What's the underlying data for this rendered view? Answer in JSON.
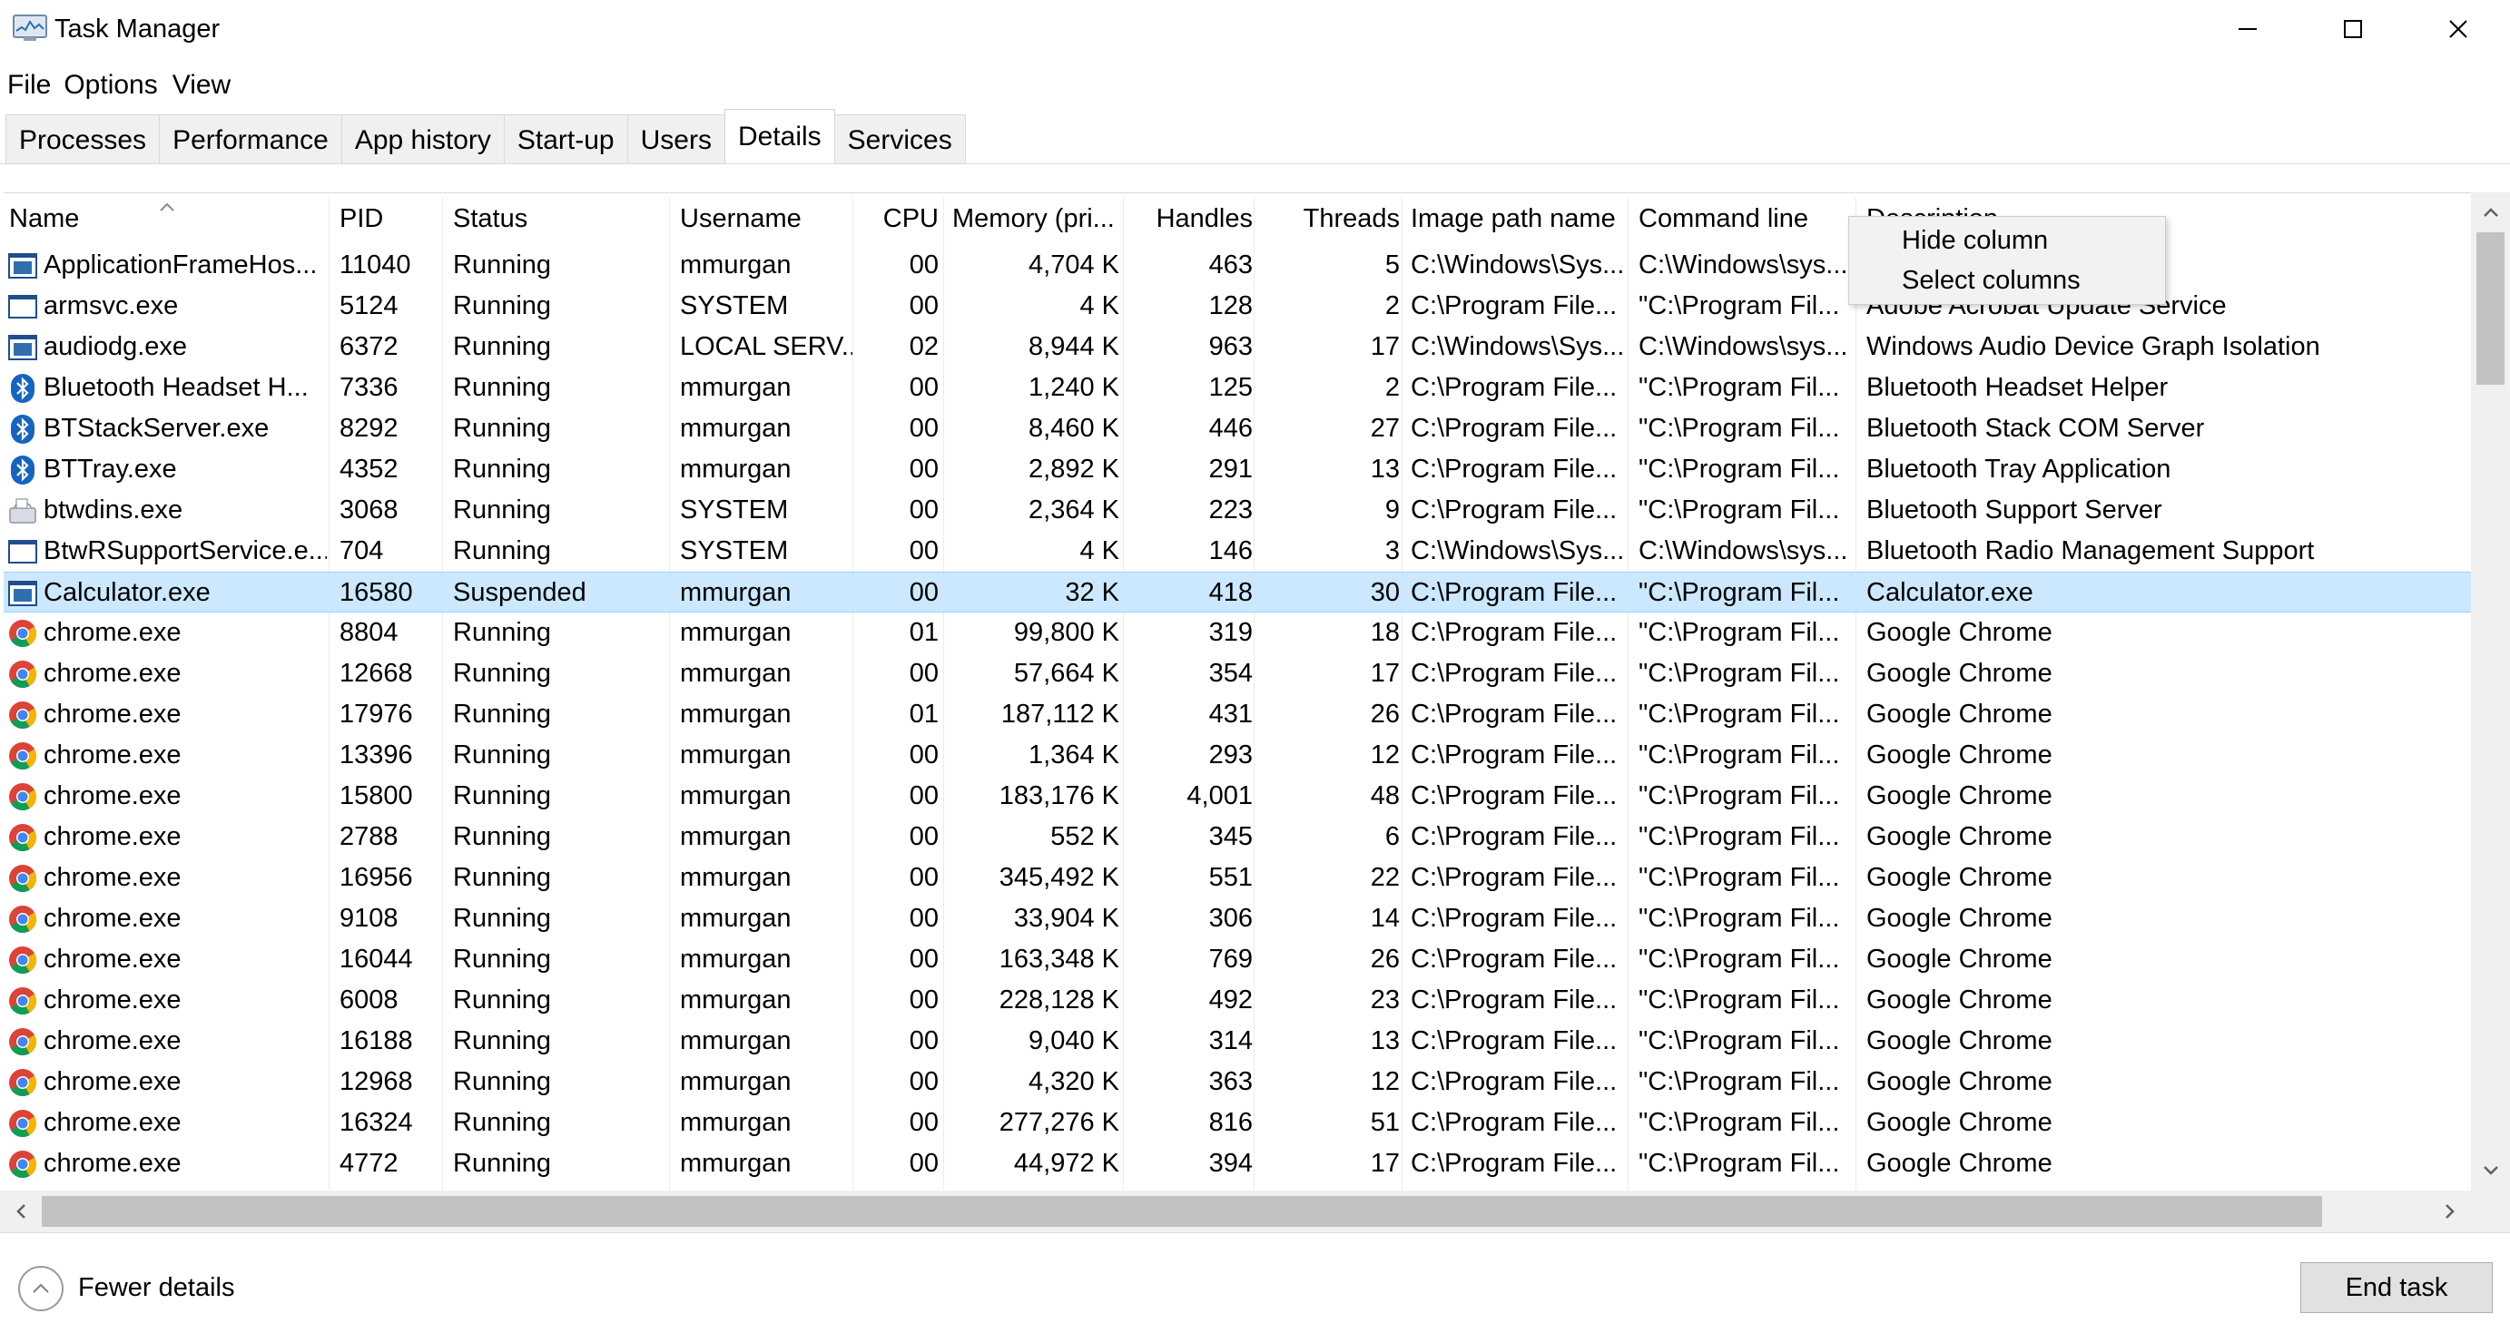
{
  "window": {
    "title": "Task Manager",
    "app_icon": "task-manager-icon",
    "controls": [
      "minimize-icon",
      "maximize-icon",
      "close-icon"
    ]
  },
  "menu": {
    "file": "File",
    "options": "Options",
    "view": "View"
  },
  "tabs": [
    {
      "label": "Processes",
      "active": false
    },
    {
      "label": "Performance",
      "active": false
    },
    {
      "label": "App history",
      "active": false
    },
    {
      "label": "Start-up",
      "active": false
    },
    {
      "label": "Users",
      "active": false
    },
    {
      "label": "Details",
      "active": true
    },
    {
      "label": "Services",
      "active": false
    }
  ],
  "table": {
    "sort_column": "Name",
    "columns": [
      "Name",
      "PID",
      "Status",
      "Username",
      "CPU",
      "Memory (pri...",
      "Handles",
      "Threads",
      "Image path name",
      "Command line",
      "Description"
    ],
    "rows": [
      {
        "icon": "app-window-icon",
        "name": "ApplicationFrameHos...",
        "pid": "11040",
        "status": "Running",
        "user": "mmurgan",
        "cpu": "00",
        "mem": "4,704 K",
        "handles": "463",
        "threads": "5",
        "path": "C:\\Windows\\Sys...",
        "cmd": "C:\\Windows\\sys...",
        "desc": ""
      },
      {
        "icon": "blank-window-icon",
        "name": "armsvc.exe",
        "pid": "5124",
        "status": "Running",
        "user": "SYSTEM",
        "cpu": "00",
        "mem": "4 K",
        "handles": "128",
        "threads": "2",
        "path": "C:\\Program File...",
        "cmd": "\"C:\\Program Fil...",
        "desc": "Adobe Acrobat Update Service"
      },
      {
        "icon": "app-window-icon",
        "name": "audiodg.exe",
        "pid": "6372",
        "status": "Running",
        "user": "LOCAL SERV...",
        "cpu": "02",
        "mem": "8,944 K",
        "handles": "963",
        "threads": "17",
        "path": "C:\\Windows\\Sys...",
        "cmd": "C:\\Windows\\sys...",
        "desc": "Windows Audio Device Graph Isolation"
      },
      {
        "icon": "bluetooth-icon",
        "name": "Bluetooth Headset H...",
        "pid": "7336",
        "status": "Running",
        "user": "mmurgan",
        "cpu": "00",
        "mem": "1,240 K",
        "handles": "125",
        "threads": "2",
        "path": "C:\\Program File...",
        "cmd": "\"C:\\Program Fil...",
        "desc": "Bluetooth Headset Helper"
      },
      {
        "icon": "bluetooth-icon",
        "name": "BTStackServer.exe",
        "pid": "8292",
        "status": "Running",
        "user": "mmurgan",
        "cpu": "00",
        "mem": "8,460 K",
        "handles": "446",
        "threads": "27",
        "path": "C:\\Program File...",
        "cmd": "\"C:\\Program Fil...",
        "desc": "Bluetooth Stack COM Server"
      },
      {
        "icon": "bluetooth-icon",
        "name": "BTTray.exe",
        "pid": "4352",
        "status": "Running",
        "user": "mmurgan",
        "cpu": "00",
        "mem": "2,892 K",
        "handles": "291",
        "threads": "13",
        "path": "C:\\Program File...",
        "cmd": "\"C:\\Program Fil...",
        "desc": "Bluetooth Tray Application"
      },
      {
        "icon": "installer-icon",
        "name": "btwdins.exe",
        "pid": "3068",
        "status": "Running",
        "user": "SYSTEM",
        "cpu": "00",
        "mem": "2,364 K",
        "handles": "223",
        "threads": "9",
        "path": "C:\\Program File...",
        "cmd": "\"C:\\Program Fil...",
        "desc": "Bluetooth Support Server"
      },
      {
        "icon": "blank-window-icon",
        "name": "BtwRSupportService.e...",
        "pid": "704",
        "status": "Running",
        "user": "SYSTEM",
        "cpu": "00",
        "mem": "4 K",
        "handles": "146",
        "threads": "3",
        "path": "C:\\Windows\\Sys...",
        "cmd": "C:\\Windows\\sys...",
        "desc": "Bluetooth Radio Management Support"
      },
      {
        "icon": "app-window-icon",
        "name": "Calculator.exe",
        "pid": "16580",
        "status": "Suspended",
        "user": "mmurgan",
        "cpu": "00",
        "mem": "32 K",
        "handles": "418",
        "threads": "30",
        "path": "C:\\Program File...",
        "cmd": "\"C:\\Program Fil...",
        "desc": "Calculator.exe",
        "selected": true
      },
      {
        "icon": "chrome-icon",
        "name": "chrome.exe",
        "pid": "8804",
        "status": "Running",
        "user": "mmurgan",
        "cpu": "01",
        "mem": "99,800 K",
        "handles": "319",
        "threads": "18",
        "path": "C:\\Program File...",
        "cmd": "\"C:\\Program Fil...",
        "desc": "Google Chrome"
      },
      {
        "icon": "chrome-icon",
        "name": "chrome.exe",
        "pid": "12668",
        "status": "Running",
        "user": "mmurgan",
        "cpu": "00",
        "mem": "57,664 K",
        "handles": "354",
        "threads": "17",
        "path": "C:\\Program File...",
        "cmd": "\"C:\\Program Fil...",
        "desc": "Google Chrome"
      },
      {
        "icon": "chrome-icon",
        "name": "chrome.exe",
        "pid": "17976",
        "status": "Running",
        "user": "mmurgan",
        "cpu": "01",
        "mem": "187,112 K",
        "handles": "431",
        "threads": "26",
        "path": "C:\\Program File...",
        "cmd": "\"C:\\Program Fil...",
        "desc": "Google Chrome"
      },
      {
        "icon": "chrome-icon",
        "name": "chrome.exe",
        "pid": "13396",
        "status": "Running",
        "user": "mmurgan",
        "cpu": "00",
        "mem": "1,364 K",
        "handles": "293",
        "threads": "12",
        "path": "C:\\Program File...",
        "cmd": "\"C:\\Program Fil...",
        "desc": "Google Chrome"
      },
      {
        "icon": "chrome-icon",
        "name": "chrome.exe",
        "pid": "15800",
        "status": "Running",
        "user": "mmurgan",
        "cpu": "00",
        "mem": "183,176 K",
        "handles": "4,001",
        "threads": "48",
        "path": "C:\\Program File...",
        "cmd": "\"C:\\Program Fil...",
        "desc": "Google Chrome"
      },
      {
        "icon": "chrome-icon",
        "name": "chrome.exe",
        "pid": "2788",
        "status": "Running",
        "user": "mmurgan",
        "cpu": "00",
        "mem": "552 K",
        "handles": "345",
        "threads": "6",
        "path": "C:\\Program File...",
        "cmd": "\"C:\\Program Fil...",
        "desc": "Google Chrome"
      },
      {
        "icon": "chrome-icon",
        "name": "chrome.exe",
        "pid": "16956",
        "status": "Running",
        "user": "mmurgan",
        "cpu": "00",
        "mem": "345,492 K",
        "handles": "551",
        "threads": "22",
        "path": "C:\\Program File...",
        "cmd": "\"C:\\Program Fil...",
        "desc": "Google Chrome"
      },
      {
        "icon": "chrome-icon",
        "name": "chrome.exe",
        "pid": "9108",
        "status": "Running",
        "user": "mmurgan",
        "cpu": "00",
        "mem": "33,904 K",
        "handles": "306",
        "threads": "14",
        "path": "C:\\Program File...",
        "cmd": "\"C:\\Program Fil...",
        "desc": "Google Chrome"
      },
      {
        "icon": "chrome-icon",
        "name": "chrome.exe",
        "pid": "16044",
        "status": "Running",
        "user": "mmurgan",
        "cpu": "00",
        "mem": "163,348 K",
        "handles": "769",
        "threads": "26",
        "path": "C:\\Program File...",
        "cmd": "\"C:\\Program Fil...",
        "desc": "Google Chrome"
      },
      {
        "icon": "chrome-icon",
        "name": "chrome.exe",
        "pid": "6008",
        "status": "Running",
        "user": "mmurgan",
        "cpu": "00",
        "mem": "228,128 K",
        "handles": "492",
        "threads": "23",
        "path": "C:\\Program File...",
        "cmd": "\"C:\\Program Fil...",
        "desc": "Google Chrome"
      },
      {
        "icon": "chrome-icon",
        "name": "chrome.exe",
        "pid": "16188",
        "status": "Running",
        "user": "mmurgan",
        "cpu": "00",
        "mem": "9,040 K",
        "handles": "314",
        "threads": "13",
        "path": "C:\\Program File...",
        "cmd": "\"C:\\Program Fil...",
        "desc": "Google Chrome"
      },
      {
        "icon": "chrome-icon",
        "name": "chrome.exe",
        "pid": "12968",
        "status": "Running",
        "user": "mmurgan",
        "cpu": "00",
        "mem": "4,320 K",
        "handles": "363",
        "threads": "12",
        "path": "C:\\Program File...",
        "cmd": "\"C:\\Program Fil...",
        "desc": "Google Chrome"
      },
      {
        "icon": "chrome-icon",
        "name": "chrome.exe",
        "pid": "16324",
        "status": "Running",
        "user": "mmurgan",
        "cpu": "00",
        "mem": "277,276 K",
        "handles": "816",
        "threads": "51",
        "path": "C:\\Program File...",
        "cmd": "\"C:\\Program Fil...",
        "desc": "Google Chrome"
      },
      {
        "icon": "chrome-icon",
        "name": "chrome.exe",
        "pid": "4772",
        "status": "Running",
        "user": "mmurgan",
        "cpu": "00",
        "mem": "44,972 K",
        "handles": "394",
        "threads": "17",
        "path": "C:\\Program File...",
        "cmd": "\"C:\\Program Fil...",
        "desc": "Google Chrome"
      }
    ]
  },
  "context_menu": {
    "hide_column": "Hide column",
    "select_columns": "Select columns"
  },
  "footer": {
    "fewer_details": "Fewer details",
    "end_task": "End task"
  },
  "colors": {
    "selected_row": "#cce8ff",
    "selected_border": "#99d1ff",
    "scrollbar_thumb": "#c2c2c2",
    "button_face": "#e1e1e1"
  }
}
